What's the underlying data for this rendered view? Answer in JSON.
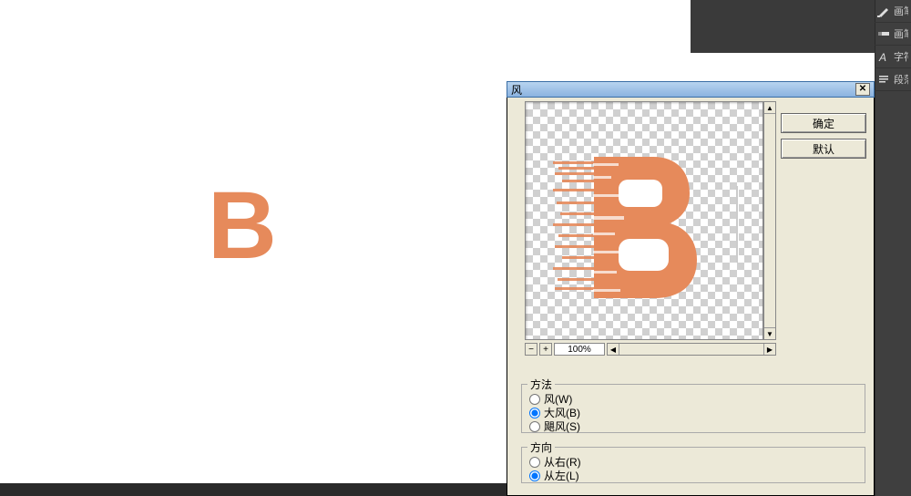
{
  "canvas": {
    "letter": "B"
  },
  "right_panels": {
    "items": [
      "画笔",
      "画笔",
      "字符",
      "段落"
    ]
  },
  "dialog": {
    "title": "风",
    "close_glyph": "✕",
    "preview_letter": "B",
    "zoom": {
      "pct_label": "100%",
      "minus": "−",
      "plus": "+"
    },
    "buttons": {
      "ok": "确定",
      "default": "默认"
    },
    "method": {
      "legend": "方法",
      "options": [
        {
          "key": "wind",
          "label": "风(W)"
        },
        {
          "key": "blast",
          "label": "大风(B)"
        },
        {
          "key": "storm",
          "label": "飓风(S)"
        }
      ],
      "selected": "blast"
    },
    "direction": {
      "legend": "方向",
      "options": [
        {
          "key": "right",
          "label": "从右(R)"
        },
        {
          "key": "left",
          "label": "从左(L)"
        }
      ],
      "selected": "left"
    }
  }
}
